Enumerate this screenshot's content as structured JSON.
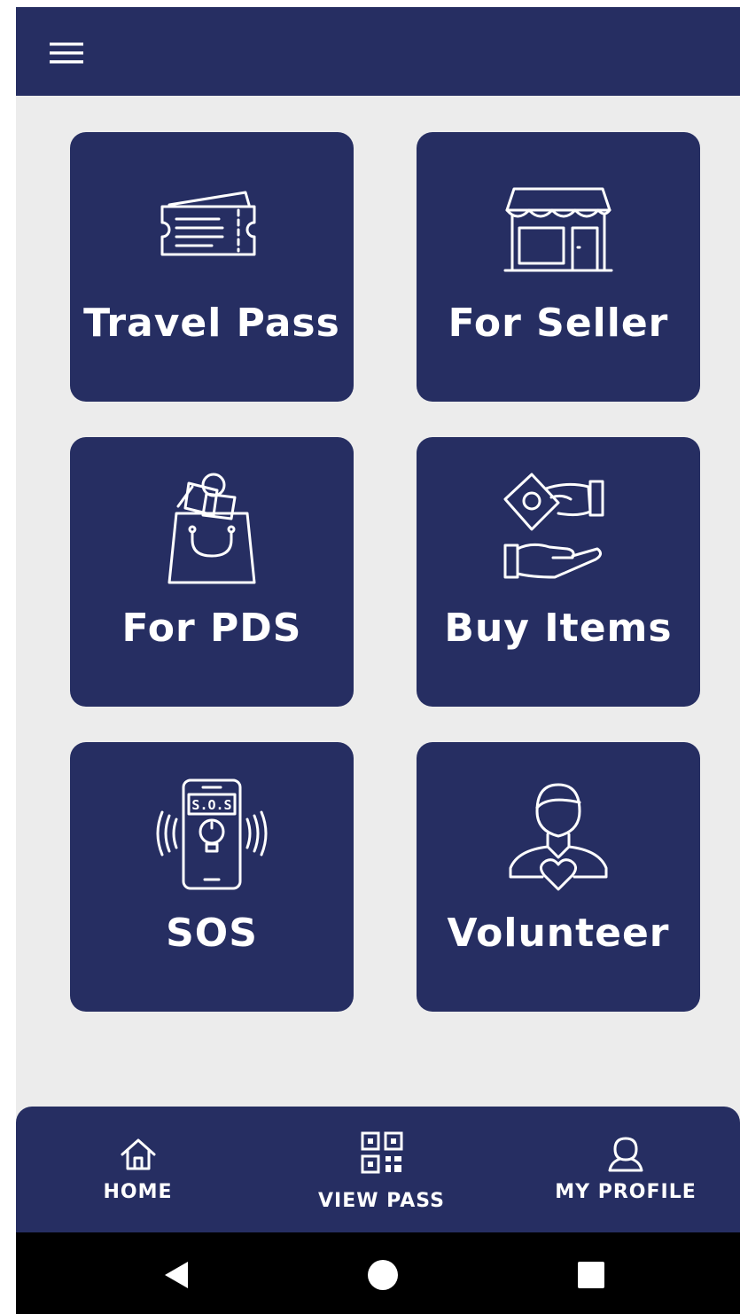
{
  "app_bar": {
    "menu_icon": "hamburger-menu-icon"
  },
  "tiles": [
    {
      "label": "Travel Pass",
      "icon": "ticket-icon"
    },
    {
      "label": "For Seller",
      "icon": "storefront-icon"
    },
    {
      "label": "For PDS",
      "icon": "grocery-bag-icon"
    },
    {
      "label": "Buy Items",
      "icon": "hand-money-exchange-icon"
    },
    {
      "label": "SOS",
      "icon": "sos-phone-alarm-icon"
    },
    {
      "label": "Volunteer",
      "icon": "volunteer-heart-icon"
    }
  ],
  "bottom_nav": {
    "items": [
      {
        "label": "HOME",
        "icon": "home-icon"
      },
      {
        "label": "VIEW PASS",
        "icon": "qr-code-icon"
      },
      {
        "label": "MY PROFILE",
        "icon": "user-icon"
      }
    ]
  },
  "system_nav": {
    "back_icon": "back-triangle-icon",
    "home_icon": "home-circle-icon",
    "recents_icon": "recents-square-icon"
  },
  "colors": {
    "primary": "#262e62",
    "background": "#ececec",
    "on_primary": "#ffffff",
    "system_bar": "#000000"
  }
}
